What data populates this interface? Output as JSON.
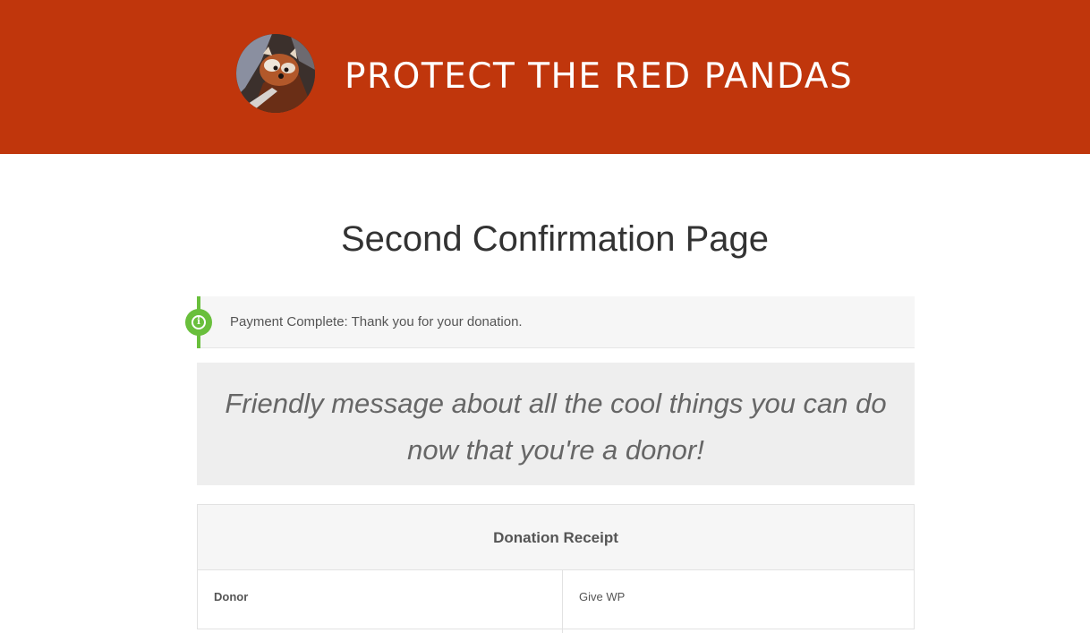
{
  "header": {
    "site_title": "PROTECT THE RED PANDAS",
    "brand_color": "#c0360c",
    "logo_icon": "red-panda-photo"
  },
  "main": {
    "page_title": "Second Confirmation Page",
    "notice": {
      "icon": "info-icon",
      "status_color": "#69bf3c",
      "text": "Payment Complete: Thank you for your donation."
    },
    "friendly_message": "Friendly message about all the cool things you can do now that you're a donor!",
    "receipt": {
      "title": "Donation Receipt",
      "rows": [
        {
          "label": "Donor",
          "value": "Give WP"
        }
      ]
    }
  }
}
